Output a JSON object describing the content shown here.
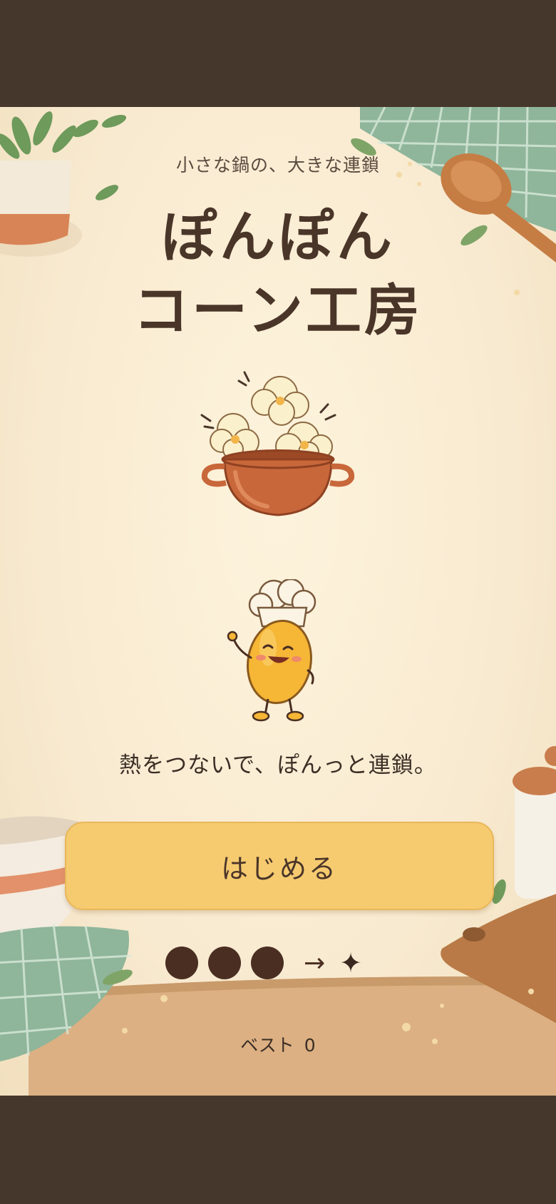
{
  "title": {
    "subtitle": "小さな鍋の、大きな連鎖",
    "line1": "ぽんぽん",
    "line2": "コーン工房"
  },
  "tagline": "熱をつないで、ぽんっと連鎖。",
  "start_button_label": "はじめる",
  "chain_hint": {
    "arrow": "→",
    "star": "✦"
  },
  "best": {
    "label": "ベスト",
    "value": "0"
  },
  "colors": {
    "background": "#f8ead0",
    "button": "#f6cb70",
    "text": "#4a3529",
    "frame": "#45372c"
  }
}
